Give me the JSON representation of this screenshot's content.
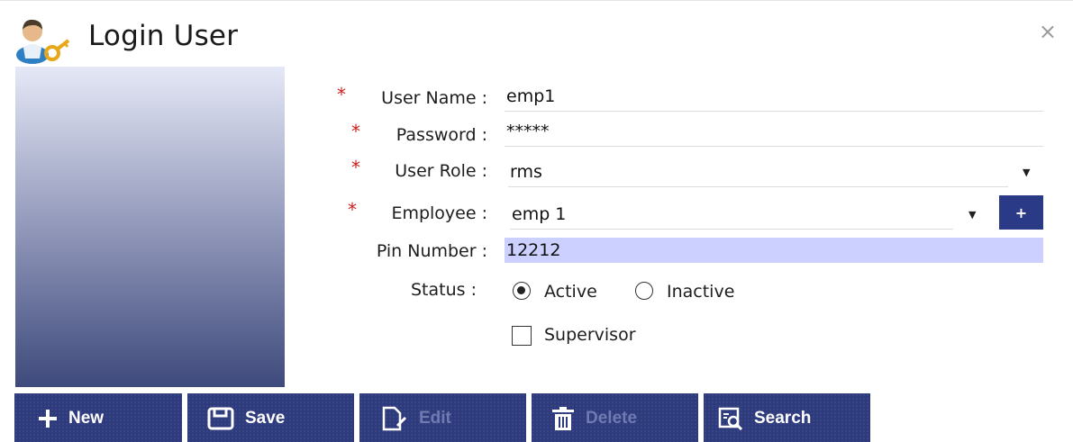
{
  "window": {
    "title": "Login User",
    "close_label": "×"
  },
  "form": {
    "user_name": {
      "label": "User Name :",
      "value": "emp1",
      "required_mark": "*"
    },
    "password": {
      "label": "Password :",
      "value": "*****",
      "required_mark": "*"
    },
    "user_role": {
      "label": "User Role :",
      "value": "rms",
      "required_mark": "*"
    },
    "employee": {
      "label": "Employee :",
      "value": "emp 1",
      "required_mark": "*",
      "add_label": "+"
    },
    "pin_number": {
      "label": "Pin Number :",
      "value": "12212"
    },
    "status": {
      "label": "Status :",
      "options": [
        "Active",
        "Inactive"
      ],
      "selected": "Active"
    },
    "supervisor": {
      "label": "Supervisor",
      "checked": false
    }
  },
  "toolbar": {
    "new_label": "New",
    "save_label": "Save",
    "edit_label": "Edit",
    "delete_label": "Delete",
    "search_label": "Search"
  },
  "colors": {
    "accent": "#2d3a7c",
    "required": "#cc1f1f",
    "pin_bg": "#ccd0ff"
  },
  "icons": [
    "user-key-icon",
    "close-icon",
    "plus-icon",
    "save-icon",
    "edit-icon",
    "trash-icon",
    "search-icon",
    "chevron-down-icon"
  ]
}
